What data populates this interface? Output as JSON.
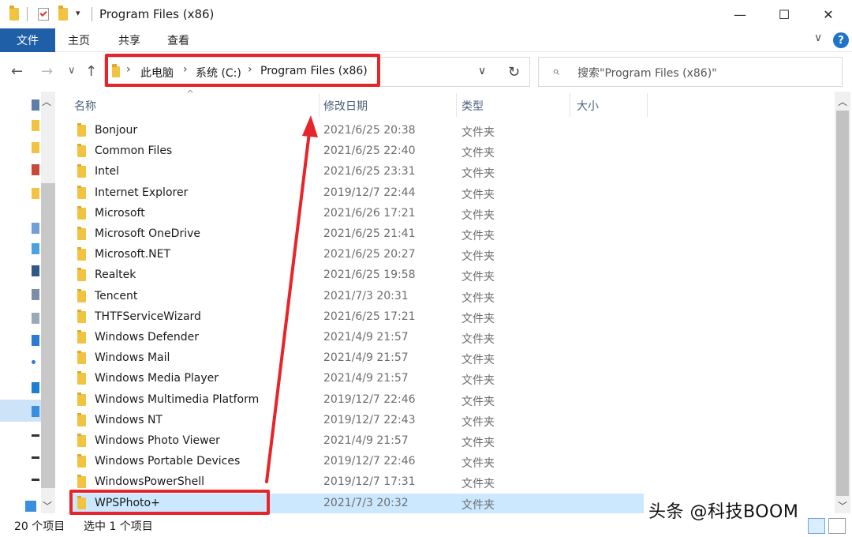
{
  "window": {
    "title": "Program Files (x86)",
    "minimize": "—",
    "maximize": "☐",
    "close": "✕"
  },
  "ribbon": {
    "tabs": [
      "文件",
      "主页",
      "共享",
      "查看"
    ],
    "expand": "∨",
    "help": "?"
  },
  "nav": {
    "back": "←",
    "forward": "→",
    "recent": "∨",
    "up": "↑",
    "breadcrumb": [
      "此电脑",
      "系统 (C:)",
      "Program Files (x86)"
    ],
    "dropdown": "∨",
    "refresh": "↻",
    "search_placeholder": "搜索\"Program Files (x86)\""
  },
  "columns": {
    "name": "名称",
    "modified": "修改日期",
    "type": "类型",
    "size": "大小"
  },
  "files": [
    {
      "name": "Bonjour",
      "modified": "2021/6/25 20:38",
      "type": "文件夹"
    },
    {
      "name": "Common Files",
      "modified": "2021/6/25 22:40",
      "type": "文件夹"
    },
    {
      "name": "Intel",
      "modified": "2021/6/25 23:31",
      "type": "文件夹"
    },
    {
      "name": "Internet Explorer",
      "modified": "2019/12/7 22:44",
      "type": "文件夹"
    },
    {
      "name": "Microsoft",
      "modified": "2021/6/26 17:21",
      "type": "文件夹"
    },
    {
      "name": "Microsoft OneDrive",
      "modified": "2021/6/25 21:41",
      "type": "文件夹"
    },
    {
      "name": "Microsoft.NET",
      "modified": "2021/6/25 20:27",
      "type": "文件夹"
    },
    {
      "name": "Realtek",
      "modified": "2021/6/25 19:58",
      "type": "文件夹"
    },
    {
      "name": "Tencent",
      "modified": "2021/7/3 20:31",
      "type": "文件夹"
    },
    {
      "name": "THTFServiceWizard",
      "modified": "2021/6/25 17:21",
      "type": "文件夹"
    },
    {
      "name": "Windows Defender",
      "modified": "2021/4/9 21:57",
      "type": "文件夹"
    },
    {
      "name": "Windows Mail",
      "modified": "2021/4/9 21:57",
      "type": "文件夹"
    },
    {
      "name": "Windows Media Player",
      "modified": "2021/4/9 21:57",
      "type": "文件夹"
    },
    {
      "name": "Windows Multimedia Platform",
      "modified": "2019/12/7 22:46",
      "type": "文件夹"
    },
    {
      "name": "Windows NT",
      "modified": "2019/12/7 22:43",
      "type": "文件夹"
    },
    {
      "name": "Windows Photo Viewer",
      "modified": "2021/4/9 21:57",
      "type": "文件夹"
    },
    {
      "name": "Windows Portable Devices",
      "modified": "2019/12/7 22:46",
      "type": "文件夹"
    },
    {
      "name": "WindowsPowerShell",
      "modified": "2019/12/7 17:31",
      "type": "文件夹"
    },
    {
      "name": "WPSPhoto+",
      "modified": "2021/7/3 20:32",
      "type": "文件夹",
      "selected": true
    }
  ],
  "status": {
    "count": "20 个项目",
    "selected": "选中 1 个项目"
  },
  "watermark": "头条 @科技BOOM",
  "colors": {
    "file_tab": "#1f5fa8",
    "selection": "#cce8ff",
    "annotation_red": "#e8242b"
  }
}
